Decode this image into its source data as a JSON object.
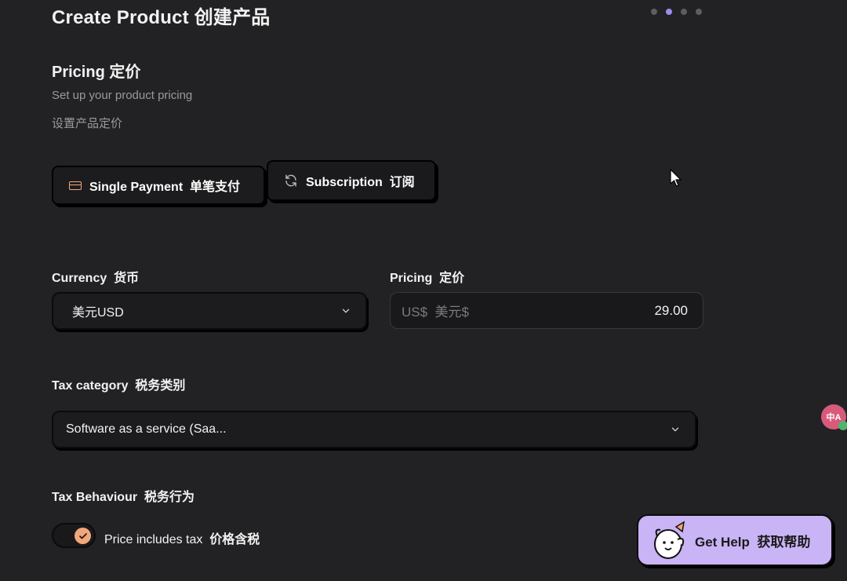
{
  "header": {
    "title": "Create Product  创建产品",
    "steps": [
      {
        "active": false
      },
      {
        "active": true
      },
      {
        "active": false
      },
      {
        "active": false
      }
    ]
  },
  "section": {
    "title": "Pricing  定价",
    "subtitle": "Set up your product pricing",
    "subtitle_cn": "设置产品定价"
  },
  "payment_type": {
    "single_label": "Single Payment  单笔支付",
    "single_icon": "credit-card-icon",
    "subscription_label": "Subscription  订阅",
    "subscription_icon": "refresh-icon"
  },
  "currency": {
    "label": "Currency  货币",
    "value": "美元USD"
  },
  "pricing": {
    "label": "Pricing  定价",
    "prefix": "US$  美元$",
    "value": "29.00"
  },
  "tax_category": {
    "label": "Tax category  税务类别",
    "value": "Software as a service (Saa..."
  },
  "tax_behaviour": {
    "label": "Tax Behaviour  税务行为",
    "toggle_label": "Price includes tax",
    "toggle_label_cn": "价格含税",
    "checked": true
  },
  "translate_badge": {
    "text": "中A"
  },
  "help": {
    "label": "Get Help  获取帮助"
  },
  "colors": {
    "background": "#222224",
    "accent_orange": "#f2a77a",
    "accent_purple": "#c9b4f6",
    "active_dot": "#9b8cf0"
  }
}
